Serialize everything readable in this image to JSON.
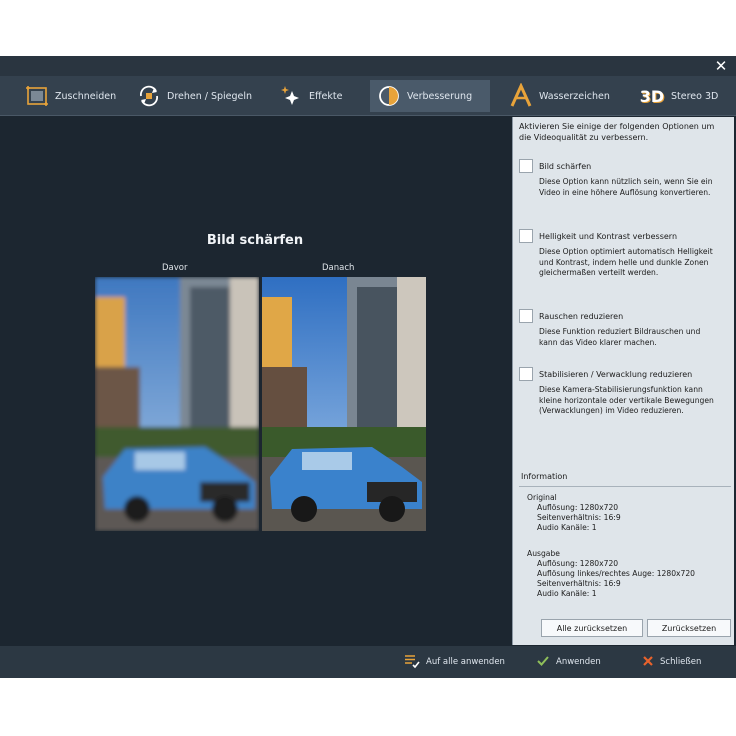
{
  "window": {
    "close_glyph": "✕"
  },
  "tabs": [
    {
      "label": "Zuschneiden",
      "icon": "crop-icon"
    },
    {
      "label": "Drehen / Spiegeln",
      "icon": "rotate-icon"
    },
    {
      "label": "Effekte",
      "icon": "sparkle-icon"
    },
    {
      "label": "Verbesserung",
      "icon": "enhance-icon",
      "active": true
    },
    {
      "label": "Wasserzeichen",
      "icon": "watermark-icon"
    },
    {
      "label": "Stereo 3D",
      "icon": "stereo-3d-icon",
      "icon_text": "3D"
    }
  ],
  "preview": {
    "title": "Bild schärfen",
    "before_label": "Davor",
    "after_label": "Danach"
  },
  "panel": {
    "intro": "Aktivieren Sie einige der folgenden Optionen um die Videoqualität zu verbessern.",
    "options": [
      {
        "label": "Bild schärfen",
        "desc": "Diese Option kann nützlich sein, wenn Sie ein Video in eine höhere Auflösung konvertieren.",
        "checked": false
      },
      {
        "label": "Helligkeit und Kontrast verbessern",
        "desc": "Diese Option optimiert automatisch Helligkeit und Kontrast, indem helle und dunkle Zonen gleichermaßen verteilt werden.",
        "checked": false
      },
      {
        "label": "Rauschen reduzieren",
        "desc": "Diese Funktion reduziert Bildrauschen und kann das Video klarer machen.",
        "checked": false
      },
      {
        "label": "Stabilisieren / Verwacklung reduzieren",
        "desc": "Diese Kamera-Stabilisierungsfunktion kann kleine horizontale oder vertikale Bewegungen (Verwacklungen) im Video reduzieren.",
        "checked": false
      }
    ],
    "info": {
      "title": "Information",
      "original": {
        "heading": "Original",
        "lines": [
          "Auflösung: 1280x720",
          "Seitenverhältnis: 16:9",
          "Audio Kanäle: 1"
        ]
      },
      "output": {
        "heading": "Ausgabe",
        "lines": [
          "Auflösung: 1280x720",
          "Auflösung linkes/rechtes Auge: 1280x720",
          "Seitenverhältnis: 16:9",
          "Audio Kanäle: 1"
        ]
      }
    },
    "reset_all_label": "Alle zurücksetzen",
    "reset_label": "Zurücksetzen"
  },
  "bottom": {
    "apply_all_label": "Auf alle anwenden",
    "apply_label": "Anwenden",
    "close_label": "Schließen"
  },
  "colors": {
    "accent": "#e8a33a",
    "background": "#1c2630",
    "panel": "#dfe5ea",
    "apply_check": "#8fbf5a",
    "close_x": "#e8622c"
  }
}
